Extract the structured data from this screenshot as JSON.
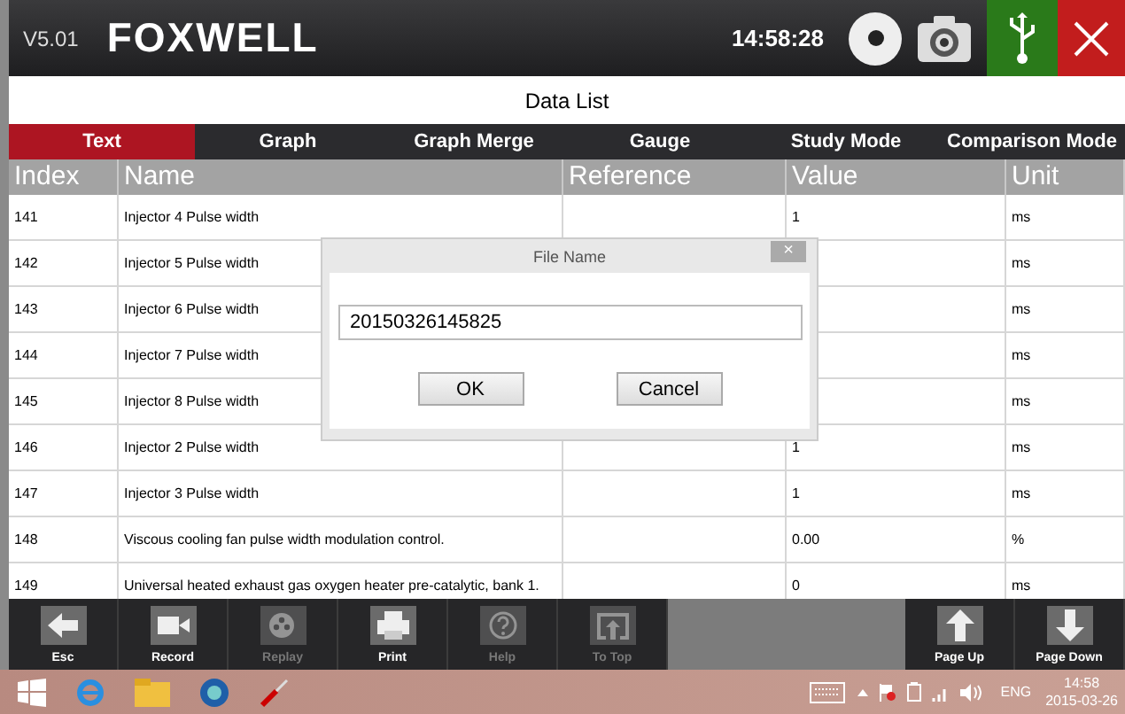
{
  "header": {
    "version": "V5.01",
    "brand": "FOXWELL",
    "time": "14:58:28"
  },
  "title": "Data List",
  "tabs": [
    {
      "label": "Text",
      "selected": true
    },
    {
      "label": "Graph",
      "selected": false
    },
    {
      "label": "Graph Merge",
      "selected": false
    },
    {
      "label": "Gauge",
      "selected": false
    },
    {
      "label": "Study Mode",
      "selected": false
    },
    {
      "label": "Comparison Mode",
      "selected": false
    }
  ],
  "table": {
    "columns": [
      "Index",
      "Name",
      "Reference",
      "Value",
      "Unit"
    ],
    "rows": [
      [
        "141",
        "Injector 4  Pulse width",
        "",
        "1",
        "ms"
      ],
      [
        "142",
        "Injector 5  Pulse width",
        "",
        "",
        "ms"
      ],
      [
        "143",
        "Injector 6  Pulse width",
        "",
        "",
        "ms"
      ],
      [
        "144",
        "Injector  7  Pulse width",
        "",
        "",
        "ms"
      ],
      [
        "145",
        "Injector  8  Pulse width",
        "",
        "",
        "ms"
      ],
      [
        "146",
        "Injector 2  Pulse width",
        "",
        "1",
        "ms"
      ],
      [
        "147",
        "Injector 3  Pulse width",
        "",
        "1",
        "ms"
      ],
      [
        "148",
        "Viscous cooling fan pulse width modulation control.",
        "",
        "0.00",
        "%"
      ],
      [
        "149",
        "Universal heated exhaust gas oxygen heater pre-catalytic, bank 1.",
        "",
        "0",
        "ms"
      ]
    ]
  },
  "dialog": {
    "title": "File Name",
    "close": "×",
    "value": "20150326145825",
    "buttons": [
      "OK",
      "Cancel"
    ]
  },
  "toolbar": [
    {
      "kind": "esc",
      "label": "Esc",
      "disabled": false
    },
    {
      "kind": "record",
      "label": "Record",
      "disabled": false
    },
    {
      "kind": "replay",
      "label": "Replay",
      "disabled": true
    },
    {
      "kind": "print",
      "label": "Print",
      "disabled": false
    },
    {
      "kind": "help",
      "label": "Help",
      "disabled": true
    },
    {
      "kind": "totop",
      "label": "To Top",
      "disabled": true
    },
    {
      "kind": "spacer"
    },
    {
      "kind": "pageup",
      "label": "Page Up",
      "disabled": false
    },
    {
      "kind": "pagedown",
      "label": "Page Down",
      "disabled": false
    }
  ],
  "taskbar": {
    "language": "ENG",
    "time": "14:58",
    "date": "2015-03-26"
  }
}
